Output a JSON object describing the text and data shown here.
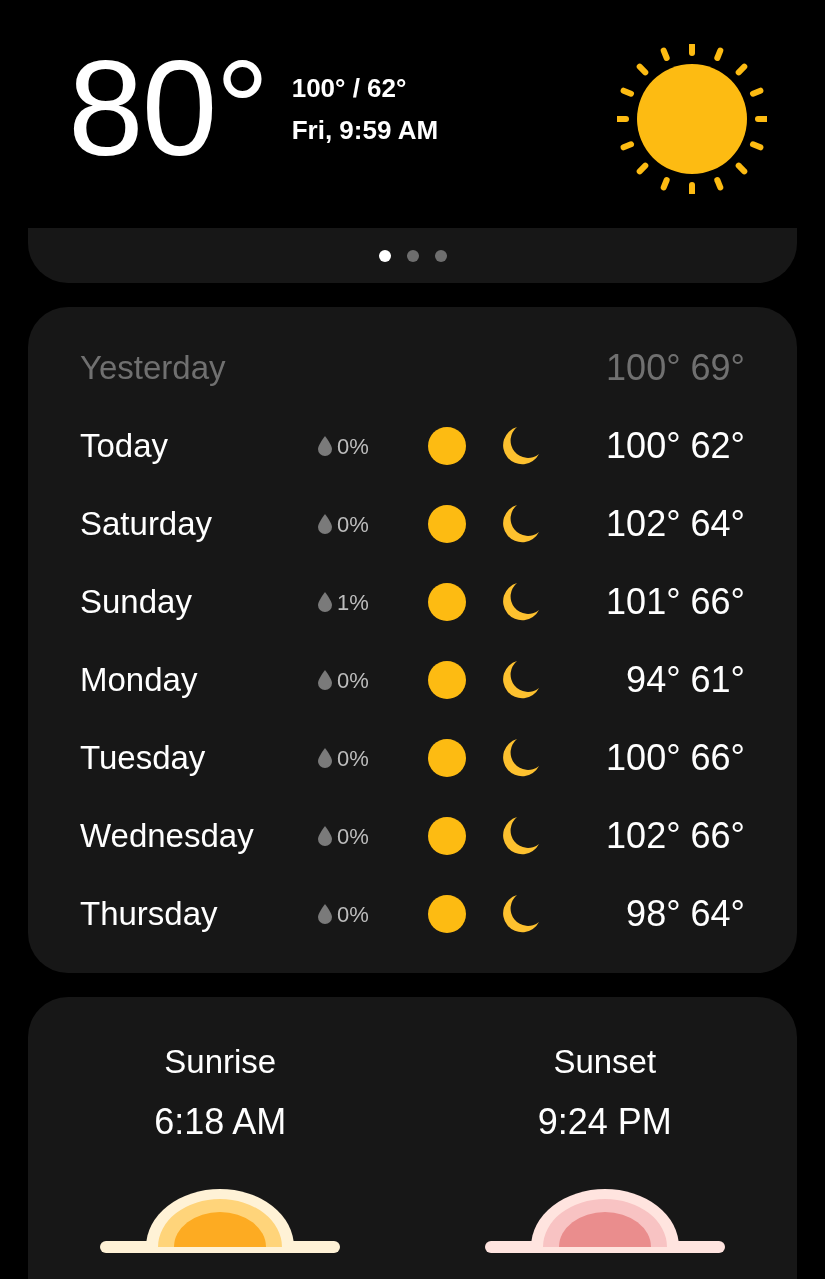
{
  "current": {
    "temperature": "80°",
    "high_low": "100° / 62°",
    "datetime": "Fri, 9:59 AM"
  },
  "pager": [
    {
      "selected": true
    },
    {
      "selected": false
    },
    {
      "selected": false
    }
  ],
  "yesterday": {
    "day": "Yesterday",
    "high": "100°",
    "low": "69°"
  },
  "forecast": [
    {
      "day": "Today",
      "precip": "0%",
      "high": "100°",
      "low": "62°"
    },
    {
      "day": "Saturday",
      "precip": "0%",
      "high": "102°",
      "low": "64°"
    },
    {
      "day": "Sunday",
      "precip": "1%",
      "high": "101°",
      "low": "66°"
    },
    {
      "day": "Monday",
      "precip": "0%",
      "high": "94°",
      "low": "61°"
    },
    {
      "day": "Tuesday",
      "precip": "0%",
      "high": "100°",
      "low": "66°"
    },
    {
      "day": "Wednesday",
      "precip": "0%",
      "high": "102°",
      "low": "66°"
    },
    {
      "day": "Thursday",
      "precip": "0%",
      "high": "98°",
      "low": "64°"
    }
  ],
  "sun_times": [
    {
      "kind": "sunrise",
      "label": "Sunrise",
      "time": "6:18 AM"
    },
    {
      "kind": "sunset",
      "label": "Sunset",
      "time": "9:24 PM"
    }
  ]
}
